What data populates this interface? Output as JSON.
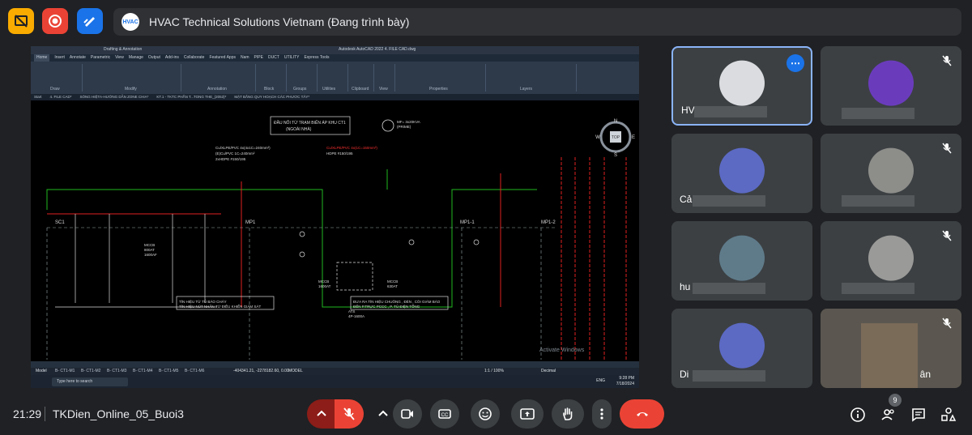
{
  "meeting": {
    "presenter_title": "HVAC Technical Solutions Vietnam (Đang trình bày)",
    "logo_text": "HVAC",
    "time": "21:29",
    "meeting_name": "TKDien_Online_05_Buoi3",
    "participant_count": "9"
  },
  "top_buttons": [
    {
      "icon": "presentation-off-icon",
      "color": "#f9ab00"
    },
    {
      "icon": "record-icon",
      "color": "#ea4335"
    },
    {
      "icon": "whiteboard-icon",
      "color": "#1a73e8"
    }
  ],
  "autocad": {
    "title": "Autodesk AutoCAD 2022   4. FILE CAD.dwg",
    "workspace": "Drafting & Annotation",
    "ribbon_tabs": [
      "Home",
      "Insert",
      "Annotate",
      "Parametric",
      "View",
      "Manage",
      "Output",
      "Add-ins",
      "Collaborate",
      "Featured Apps",
      "Nam",
      "PIPE",
      "DUCT",
      "UTILITY",
      "Express Tools"
    ],
    "ribbon_groups": [
      "Draw",
      "Modify",
      "Annotation",
      "Layers",
      "Block",
      "Properties",
      "Groups",
      "Utilities",
      "Clipboard",
      "View"
    ],
    "doc_tabs": [
      "Start",
      "4. FILE CAD*",
      "SÓNG HIỆTA-HƯỚNG DẪN ZONE CHIA*",
      "KT.1 - TKTC PHẦN T...TONG THE_(2053)*",
      "MẶT BẰNG QUY HOẠCH CÁC PHƯƠC TÂY*"
    ],
    "drawing_labels": {
      "source": "ĐẦU NỐI TỪ TRẠM BIẾN ÁP KHU CT1 (NGOÀI NHÀ)",
      "generator": "MF= 3x20KVA (PRIME)",
      "sc1": "SC1",
      "mp1": "MP1",
      "mp1_1": "MP1-1",
      "mp1_2": "MP1-2",
      "cable_left": "Cu/XLPE/PVC 4x(4x1C=240mm²)",
      "cable_left2": "(E)Cu/PVC 1C=240mm²",
      "cable_left3": "2xHDPE #150/195",
      "cable_gen": "Cu/XLPE/PVC 4x(1C=150mm²)",
      "cable_gen2": "HDPE #150/195",
      "mccb_main": "MCCB 800AT 1600AF",
      "mccb_mid": "MCCB 1600AT 1600AF",
      "mccb_right": "MCCB 630AT 630AF",
      "ats": "ATS 4P-1600A",
      "note_left": "TÍN HIỆU TỪ TỦ BÁO CHÁY TÍN HIỆU NÚT NHẤN TỪ ĐIỀU KHIỂN GIÁM SÁT",
      "note_right": "ĐƯA RA TÍN HIỆU CHUÔNG, ĐÈN, CÒI GIÁM BÁO ĐẾN P.TRỰC PCCC, P. TỦ ĐIỆN TỔNG",
      "watermark": "Activate Windows"
    },
    "layout_tabs": [
      "Model",
      "B- CT1-M1",
      "B- CT1-M2",
      "B- CT1-M3",
      "B- CT1-M4",
      "B- CT1-M5",
      "B- CT1-M6"
    ],
    "status_coords": "-404341.21, -2278182.60, 0.00",
    "status_model": "MODEL",
    "taskbar_search": "Type here to search",
    "taskbar_lang": "ENG",
    "taskbar_time": "9:28 PM",
    "taskbar_date": "7/18/2024",
    "scale": "1:1 / 100%",
    "units": "Decimal",
    "viewcube": {
      "n": "N",
      "s": "S",
      "e": "E",
      "w": "W",
      "top": "TOP"
    }
  },
  "participants": [
    {
      "name": "HV",
      "color": "#dadce0",
      "muted": false,
      "active": true
    },
    {
      "name": "",
      "color": "#6a3cbc",
      "muted": true,
      "active": false
    },
    {
      "name": "Cả",
      "color": "#5c6ac4",
      "muted": false,
      "active": false
    },
    {
      "name": "",
      "color": "#8d8d8a",
      "muted": true,
      "active": false
    },
    {
      "name": "hu",
      "color": "#5f7b8a",
      "muted": false,
      "active": false
    },
    {
      "name": "",
      "color": "#9a9a98",
      "muted": true,
      "active": false
    },
    {
      "name": "Di",
      "color": "#5c6ac4",
      "muted": false,
      "active": false
    },
    {
      "name": "ân",
      "color": "#7a6a58",
      "muted": true,
      "active": false
    }
  ],
  "controls": {
    "icons": [
      "raise-arrow-icon",
      "mic-off-icon",
      "chevron-up-icon",
      "camera-icon",
      "captions-icon",
      "emoji-icon",
      "present-icon",
      "raise-hand-icon",
      "more-options-icon",
      "end-call-icon"
    ],
    "right_icons": [
      "info-icon",
      "people-icon",
      "chat-icon",
      "activities-icon"
    ]
  }
}
